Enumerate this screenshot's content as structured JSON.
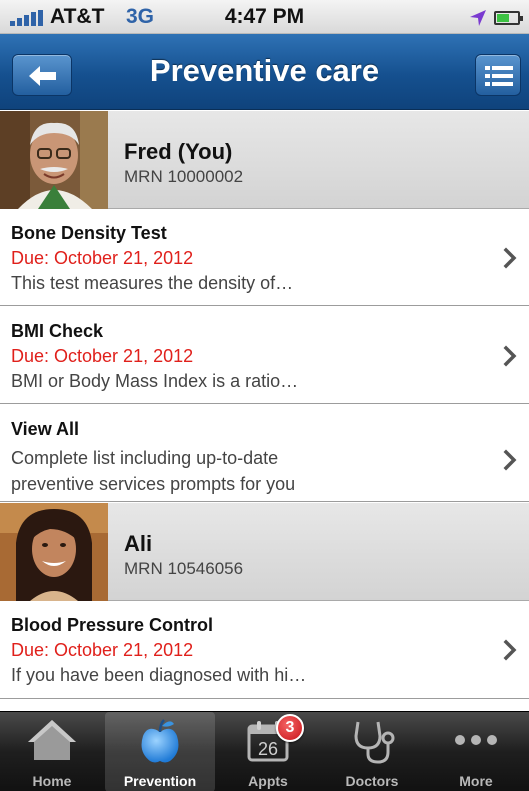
{
  "status_bar": {
    "carrier": "AT&T",
    "network": "3G",
    "time": "4:47 PM"
  },
  "nav": {
    "title": "Preventive care",
    "back_icon": "back-arrow-icon",
    "menu_icon": "list-menu-icon"
  },
  "patients": [
    {
      "name": "Fred (You)",
      "mrn": "MRN 10000002",
      "items": [
        {
          "title": "Bone Density Test",
          "due": "Due: October 21, 2012",
          "desc": "This test measures the density of…"
        },
        {
          "title": "BMI Check",
          "due": "Due: October 21, 2012",
          "desc": "BMI or Body Mass Index is a ratio…"
        },
        {
          "title": "View All",
          "desc_line1": "Complete list including up-to-date",
          "desc_line2": "preventive services prompts for you"
        }
      ]
    },
    {
      "name": "Ali",
      "mrn": "MRN 10546056",
      "items": [
        {
          "title": "Blood Pressure Control",
          "due": "Due: October 21, 2012",
          "desc": "If you have been diagnosed with hi…"
        }
      ]
    }
  ],
  "tabs": [
    {
      "label": "Home",
      "icon": "home-icon"
    },
    {
      "label": "Prevention",
      "icon": "apple-icon",
      "active": true
    },
    {
      "label": "Appts",
      "icon": "calendar-icon",
      "badge": "3",
      "calendar_day": "26"
    },
    {
      "label": "Doctors",
      "icon": "stethoscope-icon"
    },
    {
      "label": "More",
      "icon": "more-dots-icon"
    }
  ],
  "colors": {
    "nav_blue": "#15508f",
    "due_red": "#e0201b",
    "badge_red": "#c8131a"
  }
}
